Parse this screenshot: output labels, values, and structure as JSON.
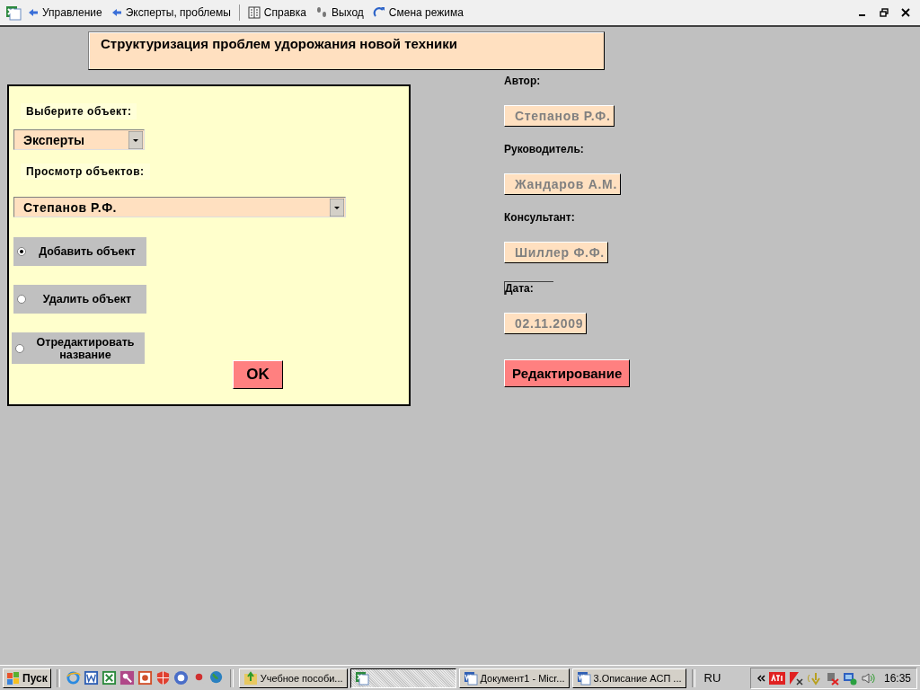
{
  "toolbar": {
    "items": [
      {
        "kind": "back",
        "label": "Управление"
      },
      {
        "kind": "back",
        "label": "Эксперты, проблемы"
      },
      {
        "kind": "book",
        "label": "Справка"
      },
      {
        "kind": "steps",
        "label": "Выход"
      },
      {
        "kind": "refresh",
        "label": "Смена режима"
      }
    ]
  },
  "form": {
    "title": "Структуризация проблем удорожания новой техники",
    "panel": {
      "select_object": {
        "label": "Выберите объект:",
        "value": "Эксперты"
      },
      "view_objects": {
        "label": "Просмотр объектов:",
        "value": "Степанов Р.Ф."
      },
      "actions": [
        {
          "label": "Добавить объект",
          "selected": true
        },
        {
          "label": "Удалить объект",
          "selected": false
        },
        {
          "label": "Отредактировать название",
          "selected": false
        }
      ],
      "ok_button": "OK"
    },
    "info": {
      "fields": [
        {
          "label": "Автор:",
          "value": "Степанов Р.Ф.",
          "disabled": true
        },
        {
          "label": "Руководитель:",
          "value": "Жандаров А.М.",
          "disabled": true
        },
        {
          "label": "Консультант:",
          "value": "Шиллер Ф.Ф.",
          "disabled": true
        },
        {
          "label": "Дата:",
          "value": "02.11.2009",
          "disabled": true
        }
      ],
      "edit_button": "Редактирование"
    }
  },
  "taskbar": {
    "start": "Пуск",
    "tasks": [
      {
        "kind": "folder",
        "label": "Учебное пособи...",
        "selected": false
      },
      {
        "kind": "excel",
        "selected": true
      },
      {
        "kind": "word",
        "label": "Документ1 - Micr...",
        "selected": false
      },
      {
        "kind": "word",
        "label": "3.Описание АСП ...",
        "selected": false
      }
    ],
    "language": "RU",
    "clock": "16:35"
  }
}
